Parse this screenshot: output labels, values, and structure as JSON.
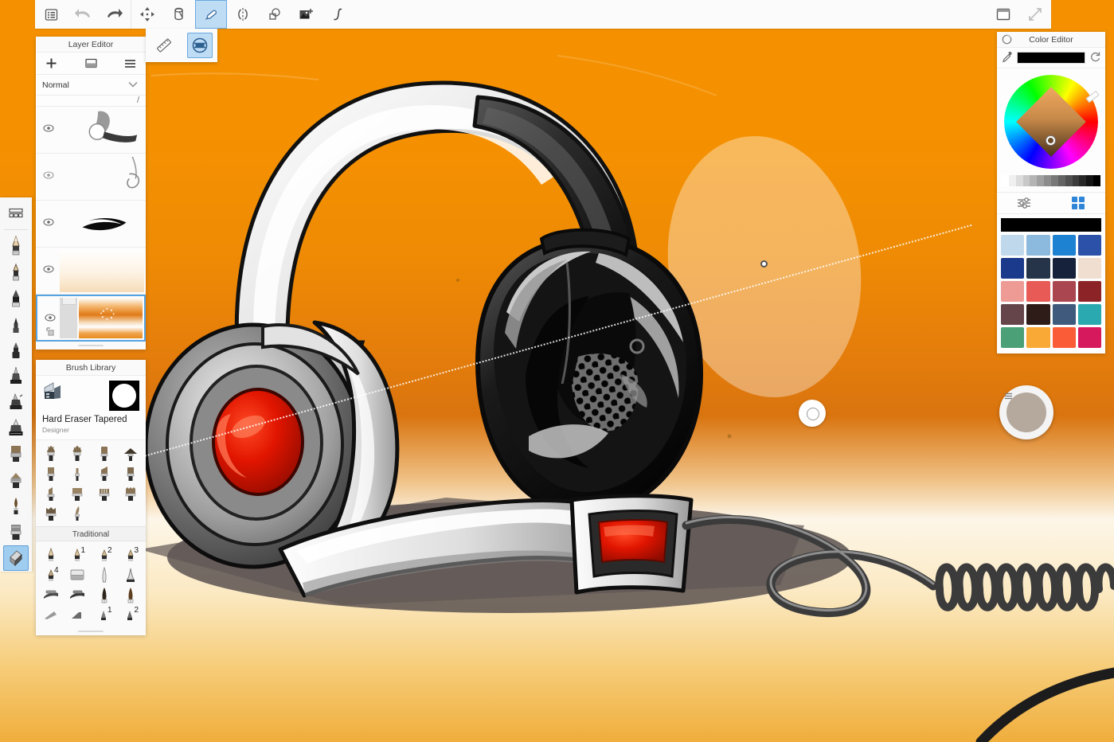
{
  "app": {
    "background_gradient": [
      "#f59100",
      "#e47d0b",
      "#fdf6e8",
      "#f0ae3c"
    ],
    "accent_selected": "#bfdcf5",
    "accent_border": "#6aa9e0"
  },
  "toolbar": {
    "items": [
      {
        "name": "menu-icon",
        "label": "Menu",
        "selected": false
      },
      {
        "name": "undo-icon",
        "label": "Undo",
        "selected": false
      },
      {
        "name": "redo-icon",
        "label": "Redo",
        "selected": false
      },
      {
        "name": "transform-icon",
        "label": "Transform",
        "selected": false
      },
      {
        "name": "bucket-fill-icon",
        "label": "Fill",
        "selected": false
      },
      {
        "name": "brush-icon",
        "label": "Brush",
        "selected": true
      },
      {
        "name": "symmetry-icon",
        "label": "Symmetry",
        "selected": false
      },
      {
        "name": "shape-icon",
        "label": "Shapes",
        "selected": false
      },
      {
        "name": "image-icon",
        "label": "Image",
        "selected": false
      },
      {
        "name": "curve-icon",
        "label": "Curve",
        "selected": false
      }
    ],
    "right_items": [
      {
        "name": "window-icon",
        "label": "Window",
        "selected": false
      },
      {
        "name": "fullscreen-icon",
        "label": "Fullscreen",
        "selected": false
      }
    ]
  },
  "tool_popover": {
    "items": [
      {
        "name": "ruler-icon",
        "label": "Ruler",
        "selected": false
      },
      {
        "name": "eraser-icon",
        "label": "Eraser",
        "selected": true
      }
    ]
  },
  "left_rail": {
    "top_item": {
      "name": "brush-grid-icon",
      "label": "Brush Presets"
    },
    "items": [
      {
        "name": "pencil-tool-icon",
        "label": "Pencil",
        "selected": false
      },
      {
        "name": "hard-pencil-tool-icon",
        "label": "Hard Pencil",
        "selected": false
      },
      {
        "name": "marker-tool-icon",
        "label": "Marker",
        "selected": false
      },
      {
        "name": "fineliner-tool-icon",
        "label": "Fineliner",
        "selected": false
      },
      {
        "name": "inkpen-tool-icon",
        "label": "Ink Pen",
        "selected": false
      },
      {
        "name": "airbrush-tool-icon",
        "label": "Airbrush",
        "selected": false
      },
      {
        "name": "spray-tool-icon",
        "label": "Spray",
        "selected": false
      },
      {
        "name": "texture-tool-icon",
        "label": "Texture Brush",
        "selected": false
      },
      {
        "name": "flat-brush-tool-icon",
        "label": "Flat Brush",
        "selected": false
      },
      {
        "name": "fan-brush-tool-icon",
        "label": "Fan Brush",
        "selected": false
      },
      {
        "name": "round-brush-tool-icon",
        "label": "Round Brush",
        "selected": false
      },
      {
        "name": "chisel-tool-icon",
        "label": "Chisel",
        "selected": false
      },
      {
        "name": "eraser-tool-icon",
        "label": "Eraser",
        "selected": true
      }
    ]
  },
  "layer_editor": {
    "title": "Layer Editor",
    "add_label": "Add Layer",
    "duplicate_label": "Duplicate Layer",
    "menu_label": "Layer Menu",
    "blend_mode": "Normal",
    "layers": [
      {
        "name": "layer-row-1",
        "visible": true,
        "selected": false,
        "thumb": "sketch-strap"
      },
      {
        "name": "layer-row-2",
        "visible": true,
        "selected": false,
        "thumb": "sketch-outline"
      },
      {
        "name": "layer-row-3",
        "visible": true,
        "selected": false,
        "thumb": "ink-stroke"
      },
      {
        "name": "layer-row-4",
        "visible": true,
        "selected": false,
        "thumb": "soft-gradient"
      },
      {
        "name": "layer-row-5",
        "visible": true,
        "selected": true,
        "thumb": "orange-background"
      }
    ]
  },
  "brush_library": {
    "title": "Brush Library",
    "selected_brush": "Hard Eraser Tapered",
    "selected_brush_author": "Designer",
    "preview_icon": "circle-brush-preview",
    "settings_icon": "brush-settings-icon",
    "grid_rows": [
      [
        "fan-bristle-1",
        "fan-bristle-2",
        "flat-tip-1",
        "fan-wide"
      ],
      [
        "flat-square-1",
        "thin-round-1",
        "angled-flat-1",
        "flat-square-2"
      ],
      [
        "angled-tip-1",
        "flat-broad-1",
        "split-flat-1",
        "rake-1"
      ],
      [
        "flat-worn-1",
        "pointed-round-1"
      ]
    ],
    "section_title": "Traditional",
    "traditional_rows": [
      [
        {
          "icon": "pencil-soft",
          "num": ""
        },
        {
          "icon": "pencil-num-1",
          "num": "1"
        },
        {
          "icon": "pencil-num-2",
          "num": "2"
        },
        {
          "icon": "pencil-num-3",
          "num": "3"
        }
      ],
      [
        {
          "icon": "pencil-num-4",
          "num": "4"
        },
        {
          "icon": "eraser-block",
          "num": ""
        },
        {
          "icon": "blender-stump",
          "num": ""
        },
        {
          "icon": "charcoal-tip",
          "num": ""
        }
      ],
      [
        {
          "icon": "nib-pen-1",
          "num": ""
        },
        {
          "icon": "nib-pen-2",
          "num": ""
        },
        {
          "icon": "marker-round-1",
          "num": ""
        },
        {
          "icon": "marker-round-2",
          "num": ""
        }
      ],
      [
        {
          "icon": "chalk-1",
          "num": ""
        },
        {
          "icon": "chalk-2",
          "num": ""
        },
        {
          "icon": "pencil-alt-1",
          "num": "1"
        },
        {
          "icon": "pencil-alt-2",
          "num": "2"
        }
      ]
    ]
  },
  "color_editor": {
    "title": "Color Editor",
    "history_icon": "color-history-icon",
    "eyedropper_icon": "eyedropper-icon",
    "reset_icon": "color-reset-icon",
    "current_color": "#000000",
    "wheel_hue_marker_color": "#ff6a00",
    "selected_swatch_color": "#6b4a28",
    "grayscale": [
      "#ffffff",
      "#f0f0f0",
      "#dcdcdc",
      "#c8c8c8",
      "#b4b4b4",
      "#a0a0a0",
      "#8c8c8c",
      "#787878",
      "#646464",
      "#505050",
      "#3c3c3c",
      "#282828",
      "#141414",
      "#000000"
    ],
    "mode_icons": [
      {
        "name": "sliders-icon",
        "label": "Sliders",
        "selected": false
      },
      {
        "name": "swatch-grid-icon",
        "label": "Swatches",
        "selected": true
      }
    ],
    "active_bar_color": "#000000",
    "palette": [
      "#c0d8ec",
      "#8cb9de",
      "#1e82d2",
      "#2b51a8",
      "#1b3a8c",
      "#253449",
      "#16213c",
      "#f0dfd0",
      "#ee9a95",
      "#e85a55",
      "#a9464f",
      "#8c2326",
      "#66454a",
      "#2e1c18",
      "#3f5a7c",
      "#2aa9b0",
      "#4ca077",
      "#f9a935",
      "#fb5c38",
      "#d6185c"
    ]
  },
  "color_puck": {
    "name": "floating-color-puck",
    "color": "#b5a89c",
    "menu_icon": "puck-menu-icon"
  },
  "canvas": {
    "artwork_title": "Headphones Concept Sketch",
    "guide_label": "perspective-guide-line",
    "cursor_label": "brush-cursor",
    "ellipse_label": "erased-ellipse-region",
    "headphone_colors": {
      "body_white": "#f2f2f2",
      "body_gray": "#8e8e8e",
      "body_dark": "#2b2b2b",
      "accent_red": "#e01b00",
      "shadow": "#5a5250"
    }
  }
}
